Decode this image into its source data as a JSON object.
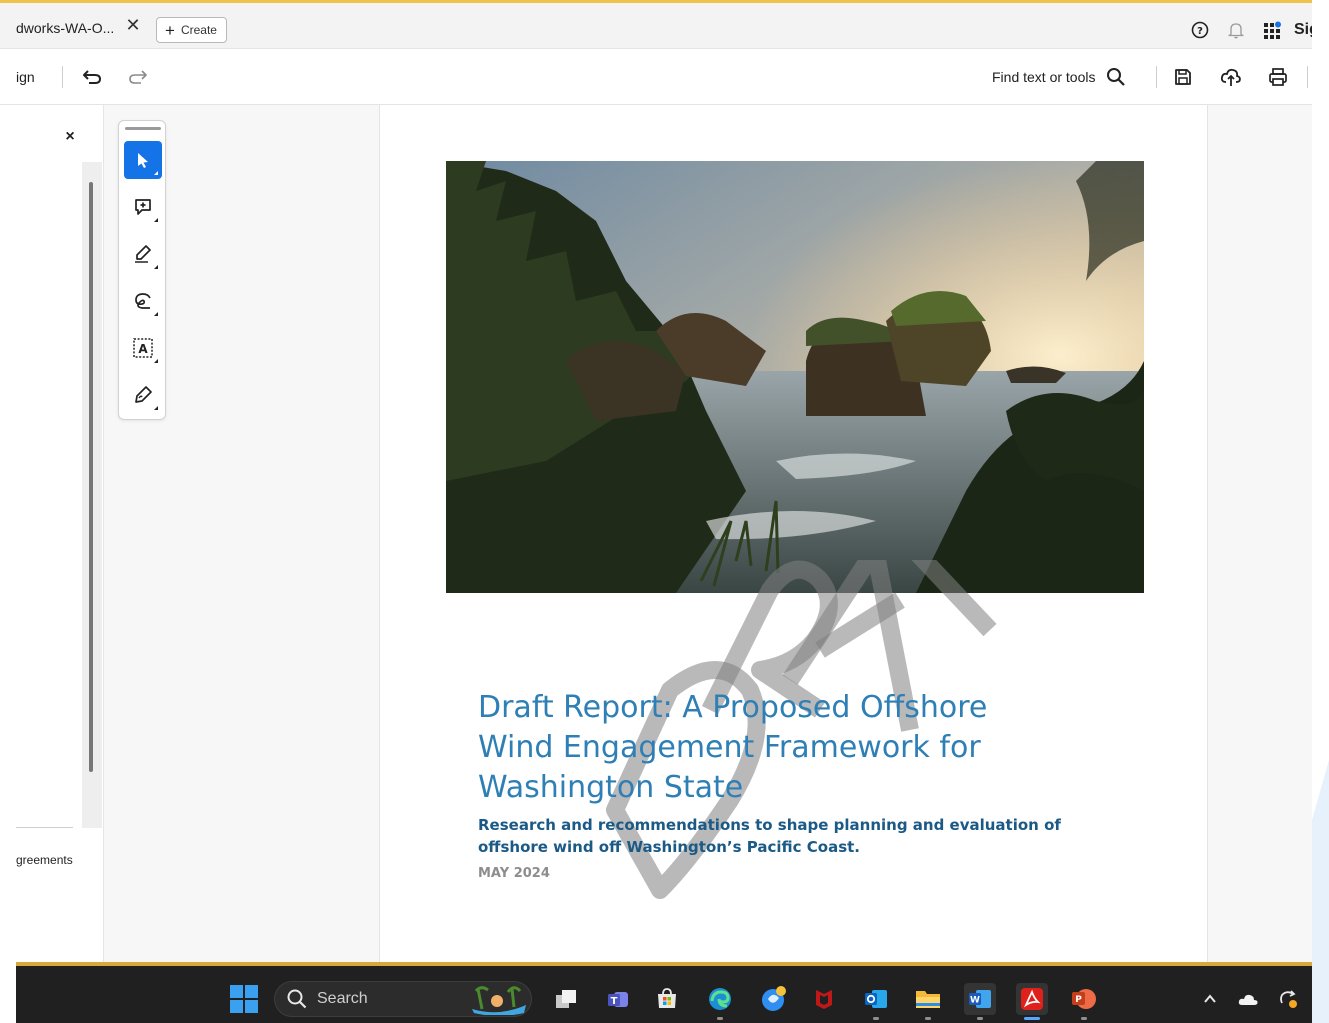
{
  "tab": {
    "title": "dworks-WA-O...",
    "create_label": "Create"
  },
  "top_right": {
    "help_icon": "help-icon",
    "bell_icon": "bell-icon",
    "apps_icon": "apps-grid-icon",
    "sign_in_label": "Sign in"
  },
  "toolbar": {
    "sign_label": "ign",
    "find_label": "Find text or tools",
    "undo_icon": "undo-icon",
    "redo_icon": "redo-icon",
    "save_icon": "save-icon",
    "upload_icon": "cloud-upload-icon",
    "print_icon": "print-icon"
  },
  "left_panel": {
    "close_label": "×",
    "agreements_label": "greements"
  },
  "quick_tools": [
    {
      "icon": "select-cursor-icon",
      "active": true
    },
    {
      "icon": "add-comment-icon",
      "active": false
    },
    {
      "icon": "highlight-pen-icon",
      "active": false
    },
    {
      "icon": "freehand-draw-icon",
      "active": false
    },
    {
      "icon": "text-recognition-icon",
      "active": false
    },
    {
      "icon": "sign-pen-icon",
      "active": false
    }
  ],
  "document": {
    "watermark_text": "DRAFT",
    "title": "Draft Report: A Proposed Offshore Wind Engagement Framework for Washington State",
    "title_lines": [
      "Draft Report: A Proposed Offshore",
      "Wind Engagement Framework for",
      "Washington State"
    ],
    "subtitle": "Research and recommendations to shape planning and evaluation of offshore wind off Washington’s Pacific Coast.",
    "subtitle_lines": [
      "Research and recommendations to shape planning and evaluation of",
      "offshore wind off Washington’s Pacific Coast."
    ],
    "date": "MAY 2024"
  },
  "taskbar": {
    "search_label": "Search",
    "apps": [
      "task-view-icon",
      "teams-icon",
      "store-icon",
      "edge-icon",
      "copilot-icon",
      "mcafee-icon",
      "outlook-icon",
      "file-explorer-icon",
      "word-icon",
      "acrobat-icon",
      "powerpoint-icon"
    ],
    "tray": [
      "chevron-up-icon",
      "onedrive-icon",
      "sync-icon"
    ]
  },
  "colors": {
    "accent_blue": "#1473e6",
    "title_blue": "#2e7fb6",
    "subtitle_blue": "#1b5a86",
    "taskbar_bg": "#202020"
  }
}
